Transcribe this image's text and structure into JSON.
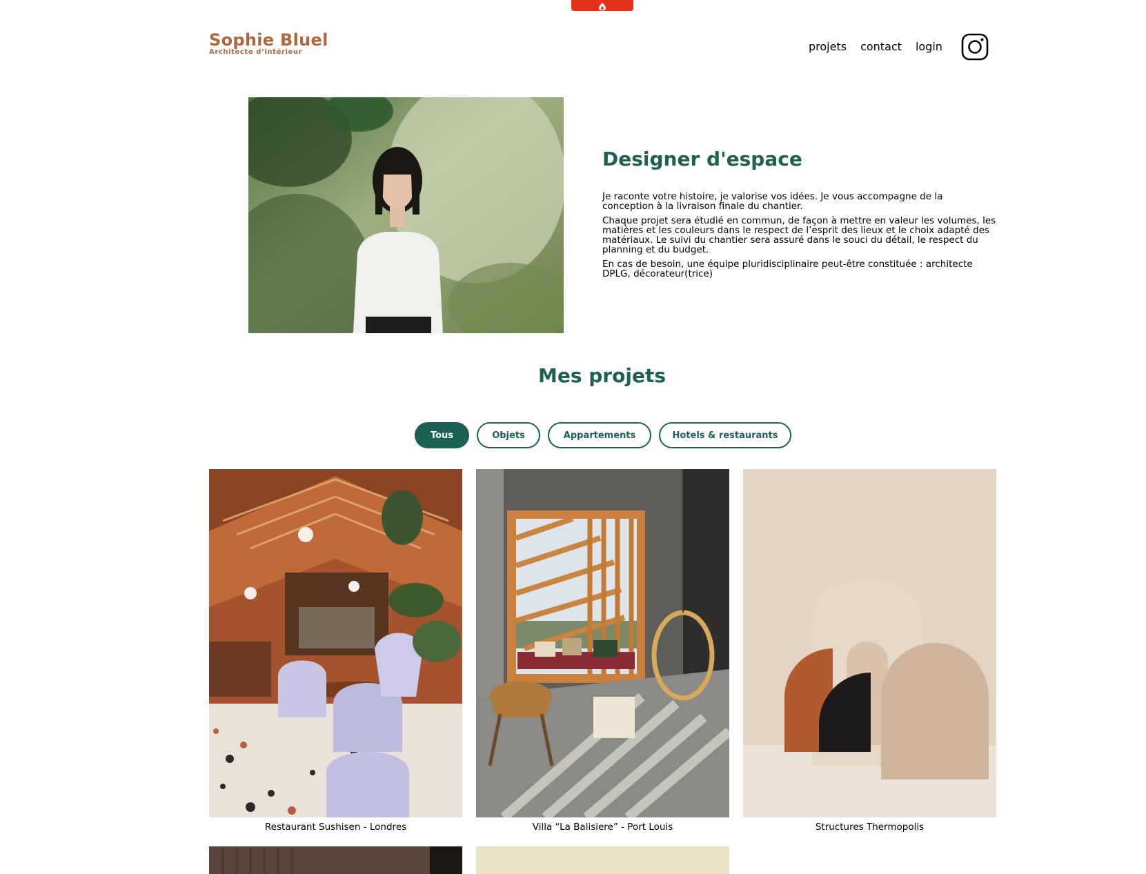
{
  "colors": {
    "brand": "#b1663c",
    "accent": "#1d6154",
    "top_tab": "#e8311a"
  },
  "header": {
    "logo_name": "Sophie Bluel",
    "logo_sub": "Architecte d’intérieur",
    "nav": [
      "projets",
      "contact",
      "login"
    ],
    "social_icon": "instagram-icon"
  },
  "intro": {
    "title": "Designer d'espace",
    "paragraphs": [
      "Je raconte votre histoire, je valorise vos idées. Je vous accompagne de la conception à la livraison finale du chantier.",
      "Chaque projet sera étudié en commun, de façon à mettre en valeur les volumes, les matières et les couleurs dans le respect de l’esprit des lieux et le choix adapté des matériaux. Le suivi du chantier sera assuré dans le souci du détail, le respect du planning et du budget.",
      "En cas de besoin, une équipe pluridisciplinaire peut-être constituée : architecte DPLG, décorateur(trice)"
    ]
  },
  "projects": {
    "title": "Mes projets",
    "filters": [
      "Tous",
      "Objets",
      "Appartements",
      "Hotels & restaurants"
    ],
    "active_filter": "Tous",
    "items": [
      {
        "caption": "Restaurant Sushisen - Londres"
      },
      {
        "caption": "Villa “La Balisiere” - Port Louis"
      },
      {
        "caption": "Structures Thermopolis"
      }
    ]
  }
}
